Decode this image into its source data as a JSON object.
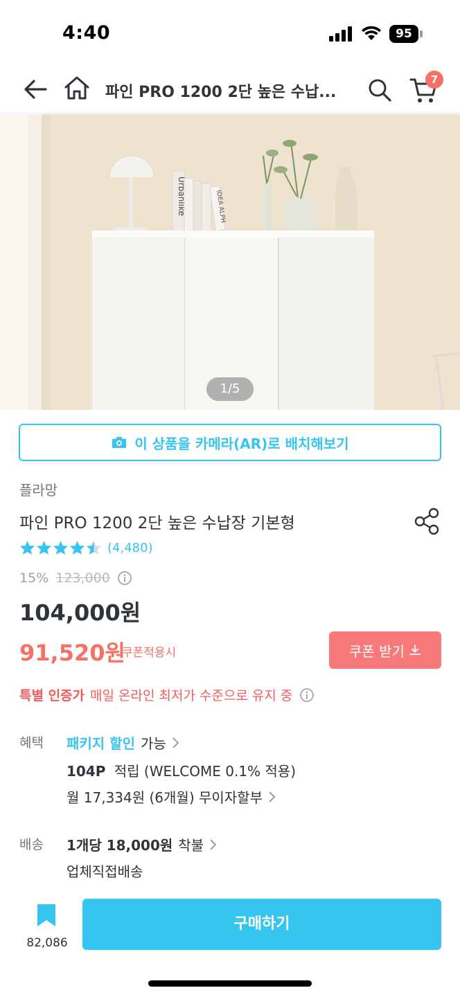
{
  "status_bar": {
    "time": "4:40",
    "battery": "95"
  },
  "nav": {
    "title": "파인 PRO 1200 2단 높은 수납...",
    "cart_count": "7"
  },
  "hero": {
    "pager": "1/5",
    "book_spines": [
      "Urbanlike",
      "IDEA ALPH"
    ]
  },
  "ar_button_label": "이 상품을 카메라(AR)로 배치해보기",
  "product": {
    "brand": "플라망",
    "name": "파인 PRO 1200 2단 높은 수납장 기본형",
    "rating": 4.5,
    "review_count": "(4,480)",
    "discount_rate": "15%",
    "original_price": "123,000",
    "price": "104,000원",
    "coupon_price": "91,520원",
    "coupon_label": "쿠폰적용시",
    "coupon_button": "쿠폰 받기",
    "special_bold": "특별 인증가",
    "special_text": "매일 온라인 최저가 수준으로 유지 중"
  },
  "benefit": {
    "label": "혜택",
    "package_accent": "패키지 할인",
    "package_text": "가능",
    "points_bold": "104P",
    "points_text": "적립 (WELCOME 0.1% 적용)",
    "installment": "월 17,334원 (6개월) 무이자할부"
  },
  "shipping": {
    "label": "배송",
    "fee_bold": "1개당 18,000원",
    "fee_text": "착불",
    "method": "업체직접배송"
  },
  "bottom": {
    "bookmark_count": "82,086",
    "buy_label": "구매하기"
  },
  "colors": {
    "accent": "#35c5f0",
    "sale": "#f77065",
    "coupon_button": "#f77979"
  },
  "icons": [
    "back-arrow-icon",
    "home-icon",
    "search-icon",
    "cart-icon",
    "camera-icon",
    "share-icon",
    "star-icon",
    "info-icon",
    "download-icon",
    "chevron-right-icon",
    "bookmark-icon"
  ]
}
